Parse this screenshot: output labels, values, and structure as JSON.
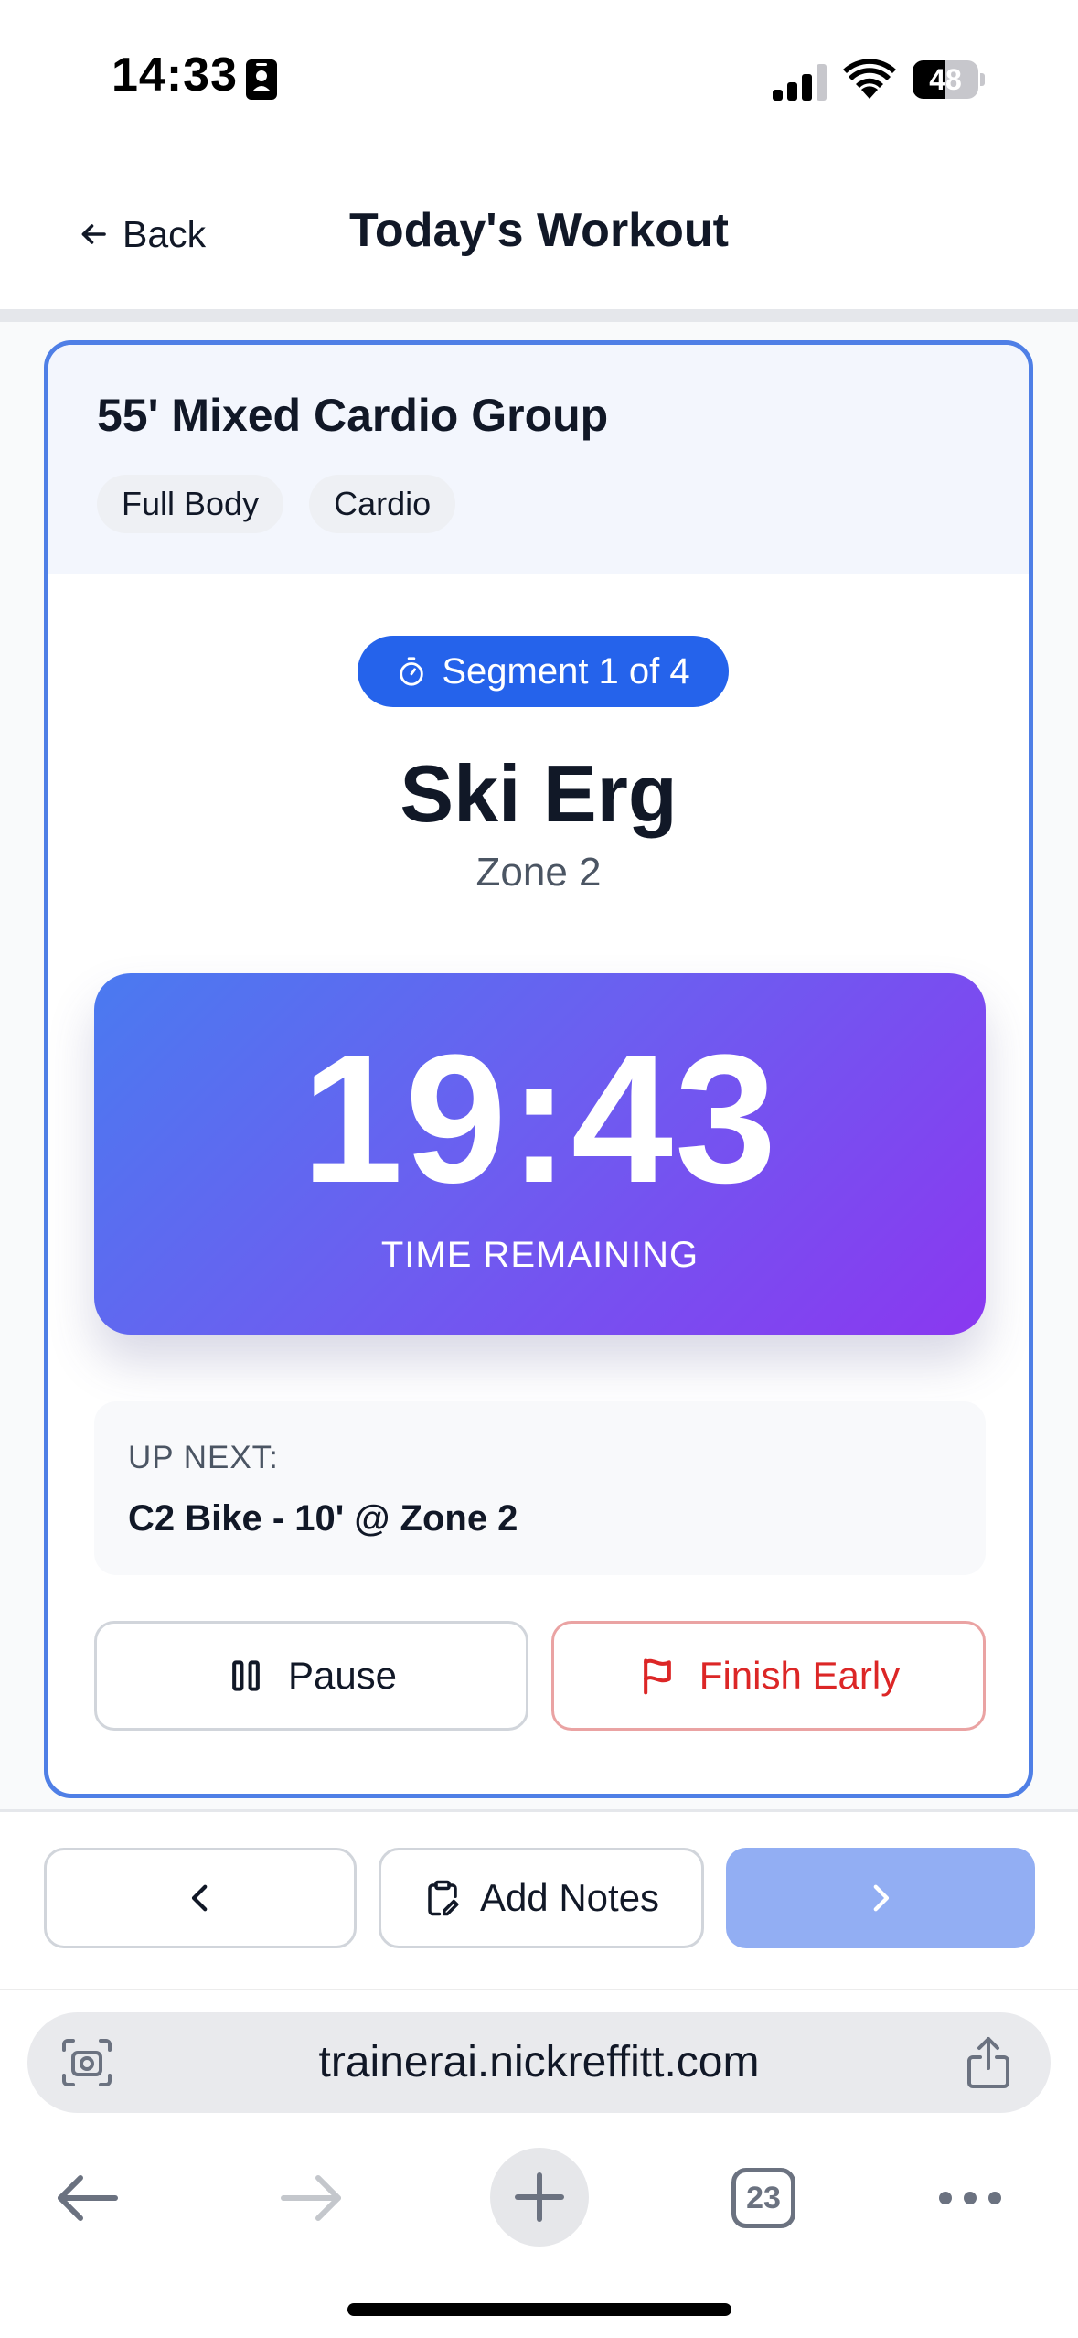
{
  "status_bar": {
    "time": "14:33",
    "battery": "48",
    "battery_level": 0.48
  },
  "header": {
    "back_label": "Back",
    "title": "Today's Workout"
  },
  "workout": {
    "title": "55' Mixed Cardio Group",
    "tags": [
      "Full Body",
      "Cardio"
    ],
    "segment_label": "Segment 1 of 4",
    "exercise_name": "Ski Erg",
    "zone": "Zone 2",
    "timer": {
      "value": "19:43",
      "label": "TIME REMAINING"
    },
    "up_next": {
      "label": "UP NEXT:",
      "value": "C2 Bike - 10' @ Zone 2"
    },
    "pause_label": "Pause",
    "finish_label": "Finish Early"
  },
  "toolbar": {
    "notes_label": "Add Notes"
  },
  "browser": {
    "url": "trainerai.nickreffitt.com",
    "tab_count": "23"
  },
  "colors": {
    "accent": "#2563eb",
    "card_border": "#4f7fe6",
    "danger": "#dc2626",
    "timer_gradient_start": "#4a7af0",
    "timer_gradient_end": "#8a38f0",
    "next_button": "#92aef3"
  },
  "icons": {
    "status_id": "person-card-icon",
    "signal": "cellular-signal-icon",
    "wifi": "wifi-icon",
    "back": "arrow-left-icon",
    "segment": "stopwatch-icon",
    "pause": "pause-icon",
    "finish": "flag-icon",
    "prev": "chevron-left-icon",
    "notes": "clipboard-edit-icon",
    "next": "chevron-right-icon",
    "camera": "camera-scan-icon",
    "share": "share-icon",
    "nav_back": "arrow-left-icon",
    "nav_forward": "arrow-right-icon",
    "new_tab": "plus-icon",
    "tabs": "tabs-icon",
    "more": "more-icon"
  }
}
